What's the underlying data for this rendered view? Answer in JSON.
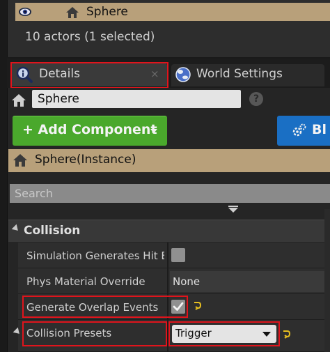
{
  "outliner": {
    "selected_row_label": "Sphere",
    "actors_status": "10 actors (1 selected)"
  },
  "tabs": [
    {
      "label": "Details",
      "close_glyph": "×",
      "icon": "details-icon"
    },
    {
      "label": "World Settings",
      "icon": "globe-icon"
    }
  ],
  "details": {
    "actor_name": "Sphere",
    "help_glyph": "?",
    "add_component_label": "+ Add Component",
    "blueprint_label": "Bl",
    "instance_label": "Sphere(Instance)",
    "search_placeholder": "Search"
  },
  "collision": {
    "title": "Collision",
    "properties": [
      {
        "label": "Simulation Generates Hit Events",
        "checked": false
      },
      {
        "label": "Phys Material Override",
        "value": "None"
      },
      {
        "label": "Generate Overlap Events",
        "checked": true
      },
      {
        "label": "Collision Presets",
        "value": "Trigger"
      }
    ]
  },
  "colors": {
    "selection_row": "#b8a07a",
    "add_component": "#4aa82c",
    "blueprint": "#1a6fc4",
    "highlight": "#e0141c",
    "reset_arrow": "#e8c020"
  }
}
